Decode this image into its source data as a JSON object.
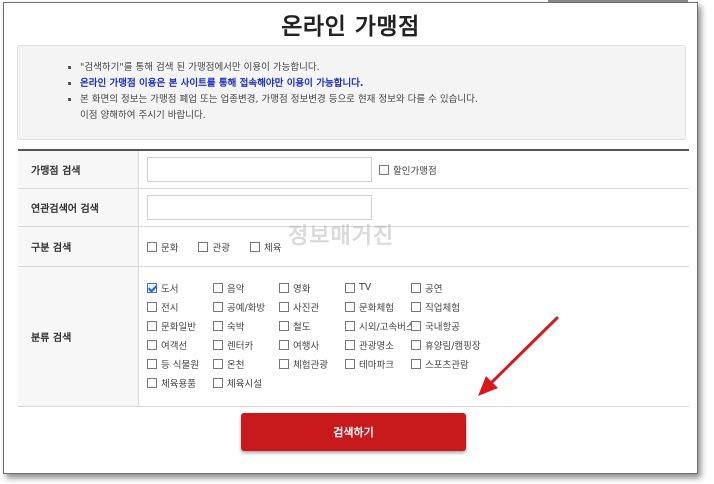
{
  "page": {
    "title": "온라인 가맹점"
  },
  "notice": {
    "lines": [
      {
        "text": "\"검색하기\"를 통해 검색 된 가맹점에서만 이용이 가능합니다."
      },
      {
        "text": "온라인 가맹점 이용은 본 사이트를 통해 접속해야만 이용이 가능합니다."
      },
      {
        "text": "본 화면의 정보는 가맹점 폐업 또는 업종변경, 가맹점 정보변경 등으로 현재 정보와 다를 수 있습니다."
      },
      {
        "text": "이점 양해하여 주시기 바랍니다."
      }
    ]
  },
  "form": {
    "store_search": {
      "label": "가맹점 검색",
      "value": "",
      "discount_label": "할인가맹점"
    },
    "keyword_search": {
      "label": "연관검색어 검색",
      "value": ""
    },
    "type_search": {
      "label": "구분 검색",
      "options": [
        "문화",
        "관광",
        "체육"
      ]
    },
    "category_search": {
      "label": "분류 검색",
      "options": [
        "도서",
        "음악",
        "영화",
        "TV",
        "공연",
        "전시",
        "공예/화방",
        "사진관",
        "문화체험",
        "직업체험",
        "문화일반",
        "숙박",
        "철도",
        "시외/고속버스",
        "국내항공",
        "여객선",
        "렌터카",
        "여행사",
        "관광명소",
        "휴양림/캠핑장",
        "등 식물원",
        "온천",
        "체험관광",
        "테마파크",
        "스포츠관람",
        "체육용품",
        "체육시설"
      ],
      "checked": "도서"
    }
  },
  "watermark": "정보매거진",
  "search_button": {
    "label": "검색하기"
  },
  "colors": {
    "accent": "#c8191c",
    "notice_highlight": "#1d2fc6",
    "arrow": "#d7191c"
  }
}
